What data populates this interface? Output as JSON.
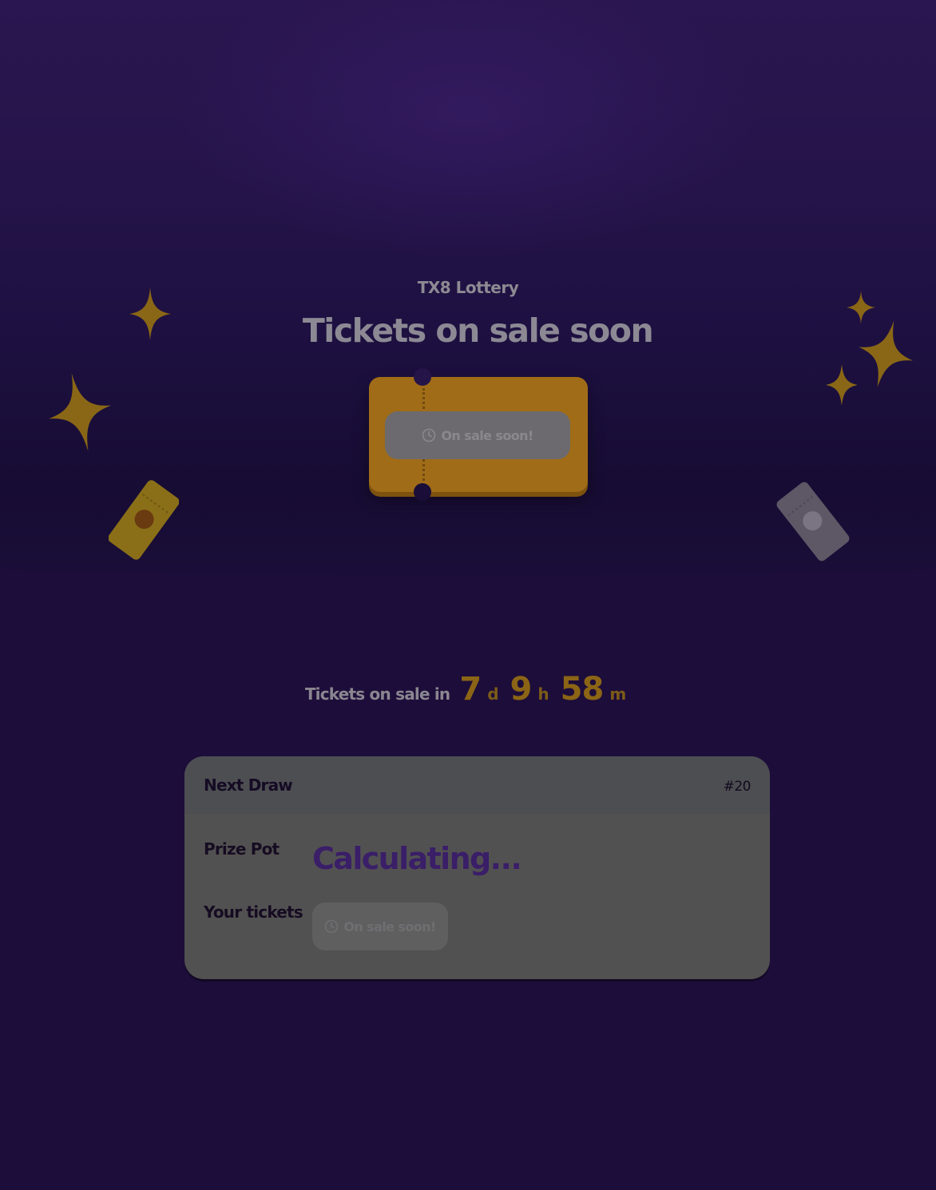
{
  "hero": {
    "eyebrow": "TX8 Lottery",
    "title": "Tickets on sale soon",
    "ticket_button_label": "On sale soon!"
  },
  "countdown": {
    "lead": "Tickets on sale in",
    "days": "7",
    "days_unit": "d",
    "hours": "9",
    "hours_unit": "h",
    "minutes": "58",
    "minutes_unit": "m"
  },
  "next_draw": {
    "title": "Next Draw",
    "round": "#20",
    "prize_pot_label": "Prize Pot",
    "prize_pot_value": "Calculating...",
    "your_tickets_label": "Your tickets",
    "tickets_button_label": "On sale soon!"
  },
  "colors": {
    "accent_gold": "#f5b52a",
    "brand_purple": "#7645d9",
    "background": "#1d0d3a"
  },
  "icons": [
    "sparkle-icon",
    "ticket-icon",
    "clock-icon"
  ]
}
